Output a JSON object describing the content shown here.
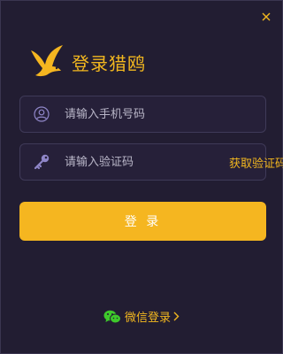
{
  "dialog": {
    "title": "登录猎鸥",
    "close_icon": "close-icon",
    "logo_icon": "seagull-logo-icon"
  },
  "phone_field": {
    "icon": "user-circle-icon",
    "placeholder": "请输入手机号码",
    "value": ""
  },
  "code_field": {
    "icon": "key-icon",
    "placeholder": "请输入验证码",
    "value": "",
    "get_code_label": "获取验证码"
  },
  "login_button": {
    "label": "登 录"
  },
  "wechat_login": {
    "icon": "wechat-icon",
    "label": "微信登录",
    "arrow_icon": "chevron-right-icon"
  },
  "colors": {
    "background": "#221d32",
    "accent": "#f5b620",
    "field_border": "#3f3a58",
    "icon_purple": "#8f86c8",
    "wechat_green": "#3ec92b"
  }
}
